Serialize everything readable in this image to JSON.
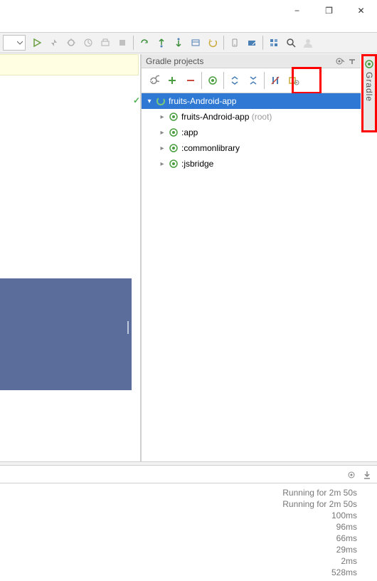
{
  "window": {
    "minimize": "−",
    "maximize": "❐",
    "close": "✕"
  },
  "gradle": {
    "title": "Gradle projects",
    "tab_label": "Gradle",
    "tree": {
      "root": "fruits-Android-app",
      "children": [
        {
          "label": "fruits-Android-app",
          "suffix": "(root)"
        },
        {
          "label": ":app",
          "suffix": ""
        },
        {
          "label": ":commonlibrary",
          "suffix": ""
        },
        {
          "label": ":jsbridge",
          "suffix": ""
        }
      ]
    }
  },
  "status": {
    "lines": [
      "Running for 2m 50s",
      "Running for 2m 50s",
      "100ms",
      "96ms",
      "66ms",
      "29ms",
      "2ms",
      "528ms"
    ]
  }
}
